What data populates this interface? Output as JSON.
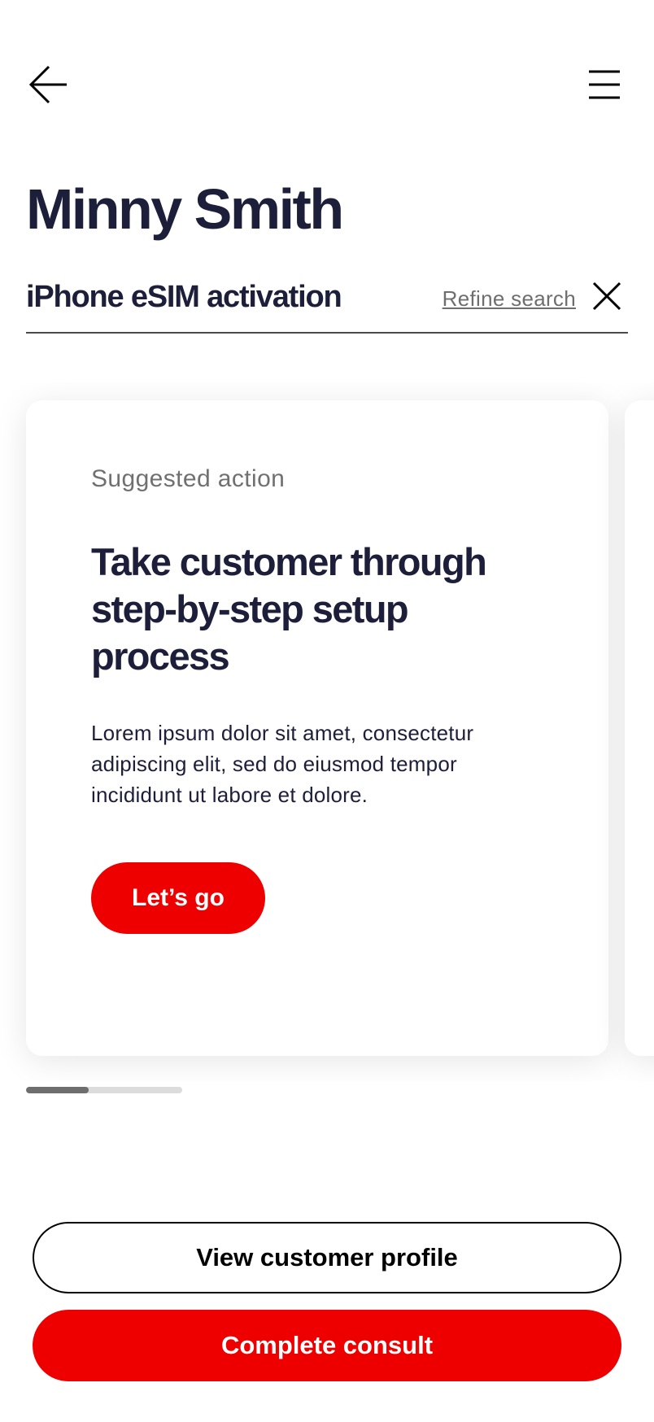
{
  "header": {
    "back_icon": "back-arrow-icon",
    "menu_icon": "hamburger-menu-icon"
  },
  "customer": {
    "name": "Minny Smith"
  },
  "search": {
    "query": "iPhone eSIM activation",
    "refine_label": "Refine search",
    "clear_icon": "close-icon"
  },
  "card": {
    "eyebrow": "Suggested action",
    "title": "Take customer through step-by-step setup process",
    "body": "Lorem ipsum dolor sit amet, consectetur adipiscing elit, sed do eiusmod tempor incididunt ut labore et dolore.",
    "cta_label": "Let’s go"
  },
  "pager": {
    "progress": 0.4
  },
  "actions": {
    "secondary_label": "View customer profile",
    "primary_label": "Complete consult"
  },
  "colors": {
    "accent": "#ee0000",
    "text": "#1d1f3a",
    "muted": "#707070",
    "divider": "#4a4a4a"
  }
}
